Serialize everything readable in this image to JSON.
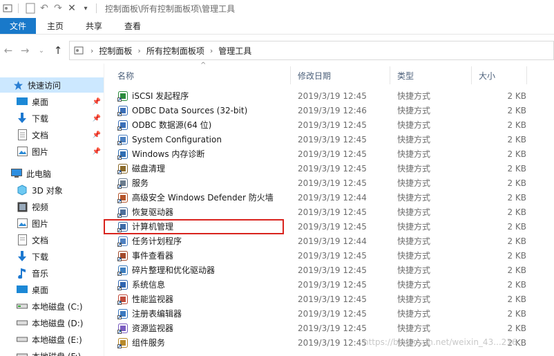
{
  "title_bar": {
    "path_text": "控制面板\\所有控制面板项\\管理工具"
  },
  "ribbon": {
    "tabs": [
      "文件",
      "主页",
      "共享",
      "查看"
    ]
  },
  "address": {
    "crumbs": [
      "控制面板",
      "所有控制面板项",
      "管理工具"
    ]
  },
  "sidebar": {
    "items": [
      {
        "label": "快速访问",
        "icon": "star-icon",
        "selected": true,
        "pinned": false
      },
      {
        "label": "桌面",
        "icon": "desktop-icon",
        "selected": false,
        "pinned": true
      },
      {
        "label": "下载",
        "icon": "download-icon",
        "selected": false,
        "pinned": true
      },
      {
        "label": "文档",
        "icon": "document-icon",
        "selected": false,
        "pinned": true
      },
      {
        "label": "图片",
        "icon": "picture-icon",
        "selected": false,
        "pinned": true
      },
      {
        "label": "此电脑",
        "icon": "computer-icon",
        "selected": false,
        "pinned": false
      },
      {
        "label": "3D 对象",
        "icon": "cube-icon",
        "selected": false,
        "pinned": false
      },
      {
        "label": "视频",
        "icon": "video-icon",
        "selected": false,
        "pinned": false
      },
      {
        "label": "图片",
        "icon": "picture-icon",
        "selected": false,
        "pinned": false
      },
      {
        "label": "文档",
        "icon": "document-icon",
        "selected": false,
        "pinned": false
      },
      {
        "label": "下载",
        "icon": "download-icon",
        "selected": false,
        "pinned": false
      },
      {
        "label": "音乐",
        "icon": "music-icon",
        "selected": false,
        "pinned": false
      },
      {
        "label": "桌面",
        "icon": "desktop-icon",
        "selected": false,
        "pinned": false
      },
      {
        "label": "本地磁盘 (C:)",
        "icon": "drive-icon",
        "selected": false,
        "pinned": false
      },
      {
        "label": "本地磁盘 (D:)",
        "icon": "drive-icon",
        "selected": false,
        "pinned": false
      },
      {
        "label": "本地磁盘 (E:)",
        "icon": "drive-icon",
        "selected": false,
        "pinned": false
      },
      {
        "label": "本地磁盘 (F:)",
        "icon": "drive-icon",
        "selected": false,
        "pinned": false
      }
    ]
  },
  "columns": [
    "名称",
    "修改日期",
    "类型",
    "大小"
  ],
  "files": [
    {
      "name": "iSCSI 发起程序",
      "date": "2019/3/19 12:45",
      "type": "快捷方式",
      "size": "2 KB",
      "icon": "globe-icon"
    },
    {
      "name": "ODBC Data Sources (32-bit)",
      "date": "2019/3/19 12:46",
      "type": "快捷方式",
      "size": "2 KB",
      "icon": "database-icon"
    },
    {
      "name": "ODBC 数据源(64 位)",
      "date": "2019/3/19 12:45",
      "type": "快捷方式",
      "size": "2 KB",
      "icon": "database-icon"
    },
    {
      "name": "System Configuration",
      "date": "2019/3/19 12:45",
      "type": "快捷方式",
      "size": "2 KB",
      "icon": "config-icon"
    },
    {
      "name": "Windows 内存诊断",
      "date": "2019/3/19 12:45",
      "type": "快捷方式",
      "size": "2 KB",
      "icon": "memory-icon"
    },
    {
      "name": "磁盘清理",
      "date": "2019/3/19 12:45",
      "type": "快捷方式",
      "size": "2 KB",
      "icon": "disk-cleanup-icon"
    },
    {
      "name": "服务",
      "date": "2019/3/19 12:45",
      "type": "快捷方式",
      "size": "2 KB",
      "icon": "gear-icon"
    },
    {
      "name": "高级安全 Windows Defender 防火墙",
      "date": "2019/3/19 12:44",
      "type": "快捷方式",
      "size": "2 KB",
      "icon": "firewall-icon"
    },
    {
      "name": "恢复驱动器",
      "date": "2019/3/19 12:45",
      "type": "快捷方式",
      "size": "2 KB",
      "icon": "recovery-icon"
    },
    {
      "name": "计算机管理",
      "date": "2019/3/19 12:45",
      "type": "快捷方式",
      "size": "2 KB",
      "icon": "computer-management-icon"
    },
    {
      "name": "任务计划程序",
      "date": "2019/3/19 12:44",
      "type": "快捷方式",
      "size": "2 KB",
      "icon": "clock-icon"
    },
    {
      "name": "事件查看器",
      "date": "2019/3/19 12:45",
      "type": "快捷方式",
      "size": "2 KB",
      "icon": "event-log-icon"
    },
    {
      "name": "碎片整理和优化驱动器",
      "date": "2019/3/19 12:45",
      "type": "快捷方式",
      "size": "2 KB",
      "icon": "defrag-icon"
    },
    {
      "name": "系统信息",
      "date": "2019/3/19 12:45",
      "type": "快捷方式",
      "size": "2 KB",
      "icon": "info-icon"
    },
    {
      "name": "性能监视器",
      "date": "2019/3/19 12:45",
      "type": "快捷方式",
      "size": "2 KB",
      "icon": "performance-icon"
    },
    {
      "name": "注册表编辑器",
      "date": "2019/3/19 12:45",
      "type": "快捷方式",
      "size": "2 KB",
      "icon": "registry-icon"
    },
    {
      "name": "资源监视器",
      "date": "2019/3/19 12:45",
      "type": "快捷方式",
      "size": "2 KB",
      "icon": "resource-monitor-icon"
    },
    {
      "name": "组件服务",
      "date": "2019/3/19 12:45",
      "type": "快捷方式",
      "size": "2 KB",
      "icon": "component-services-icon"
    }
  ],
  "watermark": "https://blog.csdn.net/weixin_43...216"
}
